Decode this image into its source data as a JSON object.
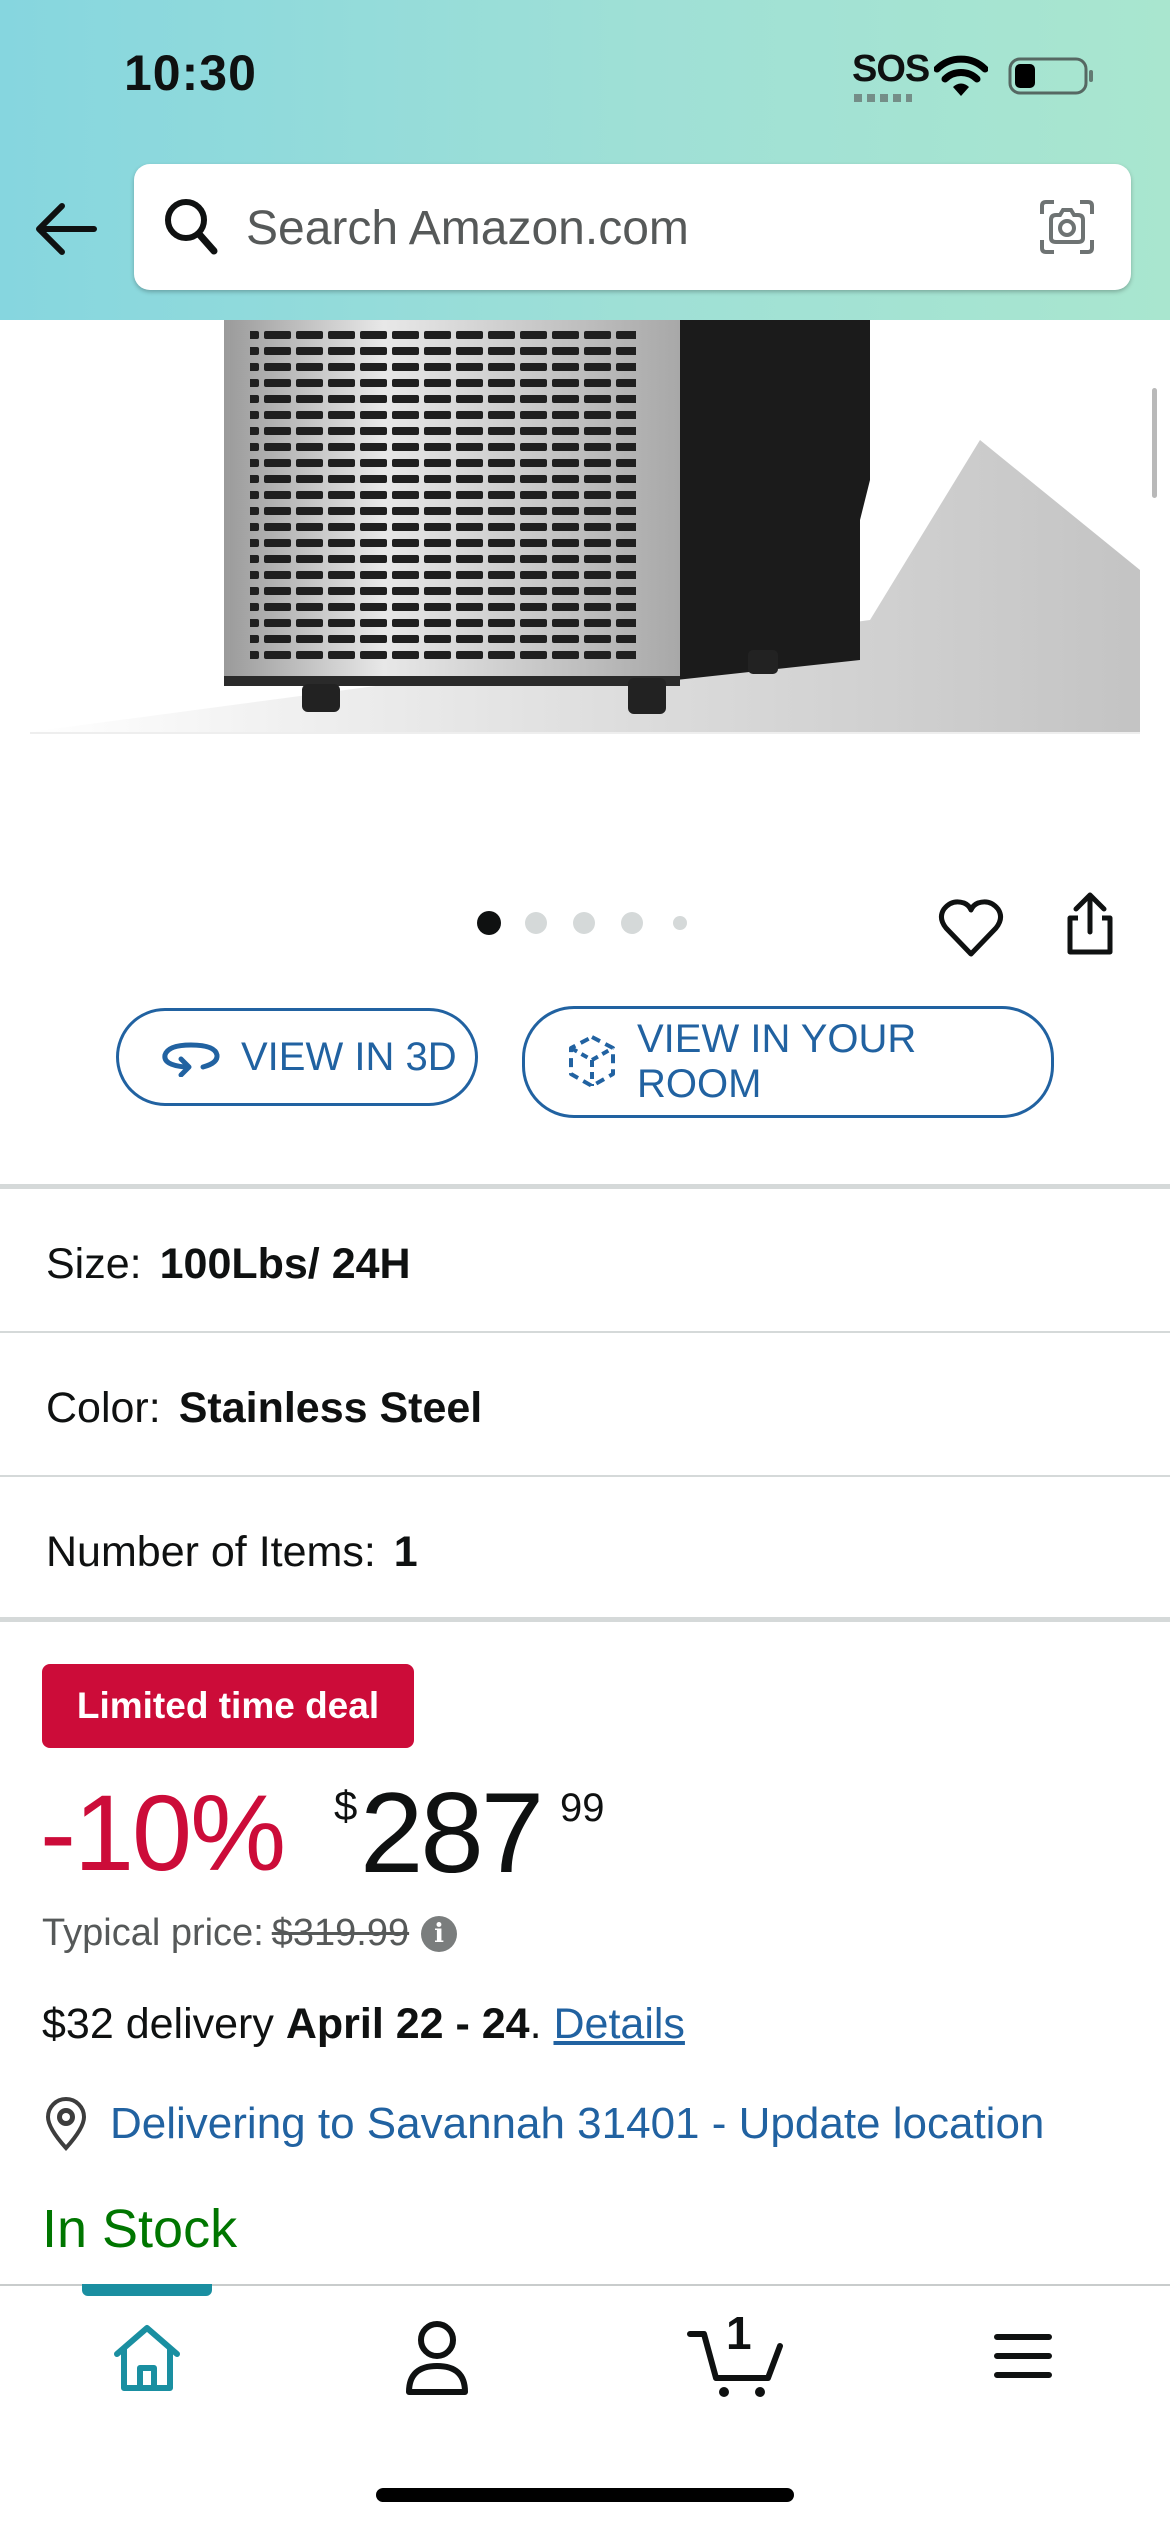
{
  "status_bar": {
    "time": "10:30",
    "sos": "SOS",
    "icons": [
      "wifi-icon",
      "battery-icon"
    ]
  },
  "search": {
    "placeholder": "Search Amazon.com",
    "icons": [
      "back-arrow-icon",
      "search-icon",
      "camera-icon"
    ]
  },
  "product_image": {
    "alt": "Stainless steel ice maker",
    "carousel_total": 5,
    "carousel_active_index": 0
  },
  "actions": {
    "view_3d": "VIEW IN 3D",
    "view_room": "VIEW IN YOUR ROOM",
    "icons": [
      "heart-icon",
      "share-icon",
      "rotate-3d-icon",
      "ar-cube-icon"
    ]
  },
  "variations": [
    {
      "label": "Size:",
      "value": "100Lbs/ 24H"
    },
    {
      "label": "Color:",
      "value": "Stainless Steel"
    },
    {
      "label": "Number of Items:",
      "value": "1"
    }
  ],
  "deal": {
    "badge": "Limited time deal",
    "discount": "-10%",
    "currency_symbol": "$",
    "price_whole": "287",
    "price_fraction": "99",
    "typical_label": "Typical price:",
    "typical_value": "$319.99"
  },
  "delivery": {
    "prefix": "$32 delivery ",
    "dates": "April 22 - 24",
    "suffix": ". ",
    "link": "Details"
  },
  "location": {
    "text": "Delivering to Savannah 31401 - Update location"
  },
  "stock": "In Stock",
  "bottom_nav": {
    "items": [
      "home-icon",
      "account-icon",
      "cart-icon",
      "menu-icon"
    ],
    "cart_count": "1"
  },
  "colors": {
    "accent_link": "#2162a1",
    "deal_red": "#cc0c39",
    "in_stock_green": "#007600",
    "nav_teal": "#1a8fa1"
  }
}
